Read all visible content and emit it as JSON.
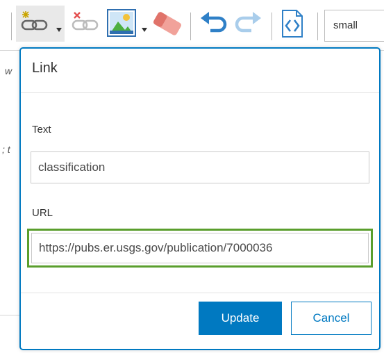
{
  "toolbar": {
    "font_size_value": "small",
    "icons": [
      "insert-link-icon",
      "unlink-icon",
      "insert-image-icon",
      "eraser-icon",
      "undo-icon",
      "redo-icon",
      "source-code-icon"
    ]
  },
  "background": {
    "snippet_1": "w",
    "snippet_2": "; t"
  },
  "dialog": {
    "title": "Link",
    "text_label": "Text",
    "text_value": "classification",
    "url_label": "URL",
    "url_value": "https://pubs.er.usgs.gov/publication/7000036",
    "update_label": "Update",
    "cancel_label": "Cancel"
  },
  "colors": {
    "accent": "#0079c1",
    "focus_outline": "#5a9e2c"
  }
}
